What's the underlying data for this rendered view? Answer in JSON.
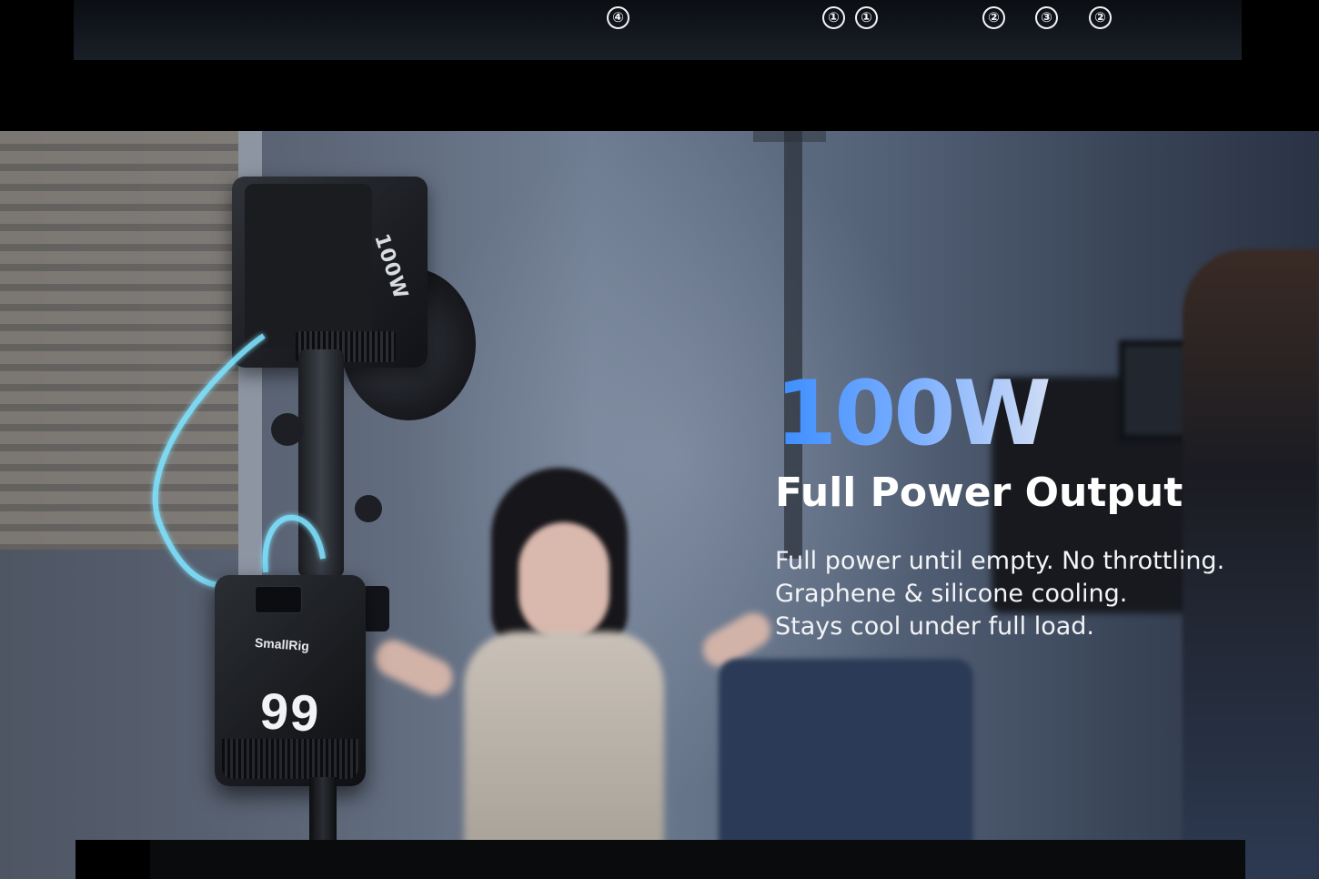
{
  "top_strip": {
    "markers": [
      "④",
      "①",
      "①",
      "②",
      "③",
      "②"
    ]
  },
  "hero": {
    "headline": "100W",
    "subheadline": "Full Power Output",
    "body_lines": [
      "Full power until empty. No throttling.",
      "Graphene & silicone cooling.",
      "Stays cool under full load."
    ],
    "light_label": "100W",
    "battery_brand": "SmallRig",
    "battery_number": "99"
  },
  "colors": {
    "headline_gradient_start": "#3b8dff",
    "headline_gradient_end": "#cfdcf5",
    "text": "#ffffff",
    "cable_glow": "#7fe3ff"
  }
}
